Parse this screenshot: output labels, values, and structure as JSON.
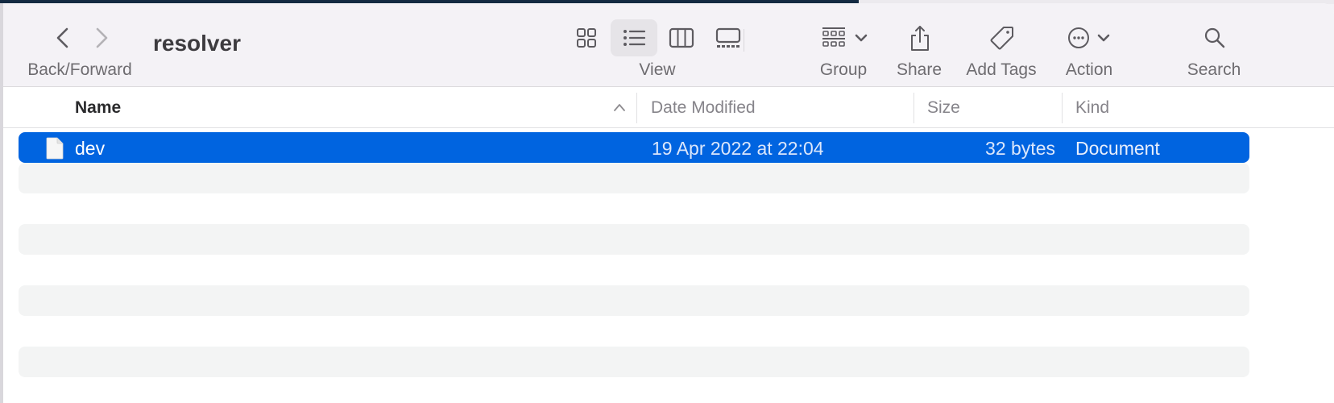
{
  "window": {
    "title": "resolver"
  },
  "toolbar": {
    "back_forward_label": "Back/Forward",
    "back": {
      "icon": "chevron-left-icon",
      "enabled": true
    },
    "forward": {
      "icon": "chevron-right-icon",
      "enabled": false
    },
    "view": {
      "label": "View",
      "modes": [
        {
          "id": "icon",
          "icon": "grid-icon",
          "selected": false
        },
        {
          "id": "list",
          "icon": "list-icon",
          "selected": true
        },
        {
          "id": "column",
          "icon": "columns-icon",
          "selected": false
        },
        {
          "id": "gallery",
          "icon": "gallery-icon",
          "selected": false
        }
      ]
    },
    "group": {
      "label": "Group",
      "icon": "group-icon"
    },
    "share": {
      "label": "Share",
      "icon": "share-icon"
    },
    "add_tags": {
      "label": "Add Tags",
      "icon": "tag-icon"
    },
    "action": {
      "label": "Action",
      "icon": "ellipsis-circle-icon"
    },
    "search": {
      "label": "Search",
      "icon": "search-icon"
    }
  },
  "columns": {
    "name": "Name",
    "date_modified": "Date Modified",
    "size": "Size",
    "kind": "Kind",
    "sort": "ascending"
  },
  "files": [
    {
      "name": "dev",
      "date_modified": "19 Apr 2022 at 22:04",
      "size": "32 bytes",
      "kind": "Document",
      "selected": true
    }
  ],
  "colors": {
    "selection": "#0064e0",
    "toolbar_bg": "#f4f2f6",
    "alt_row": "#f3f4f4"
  }
}
